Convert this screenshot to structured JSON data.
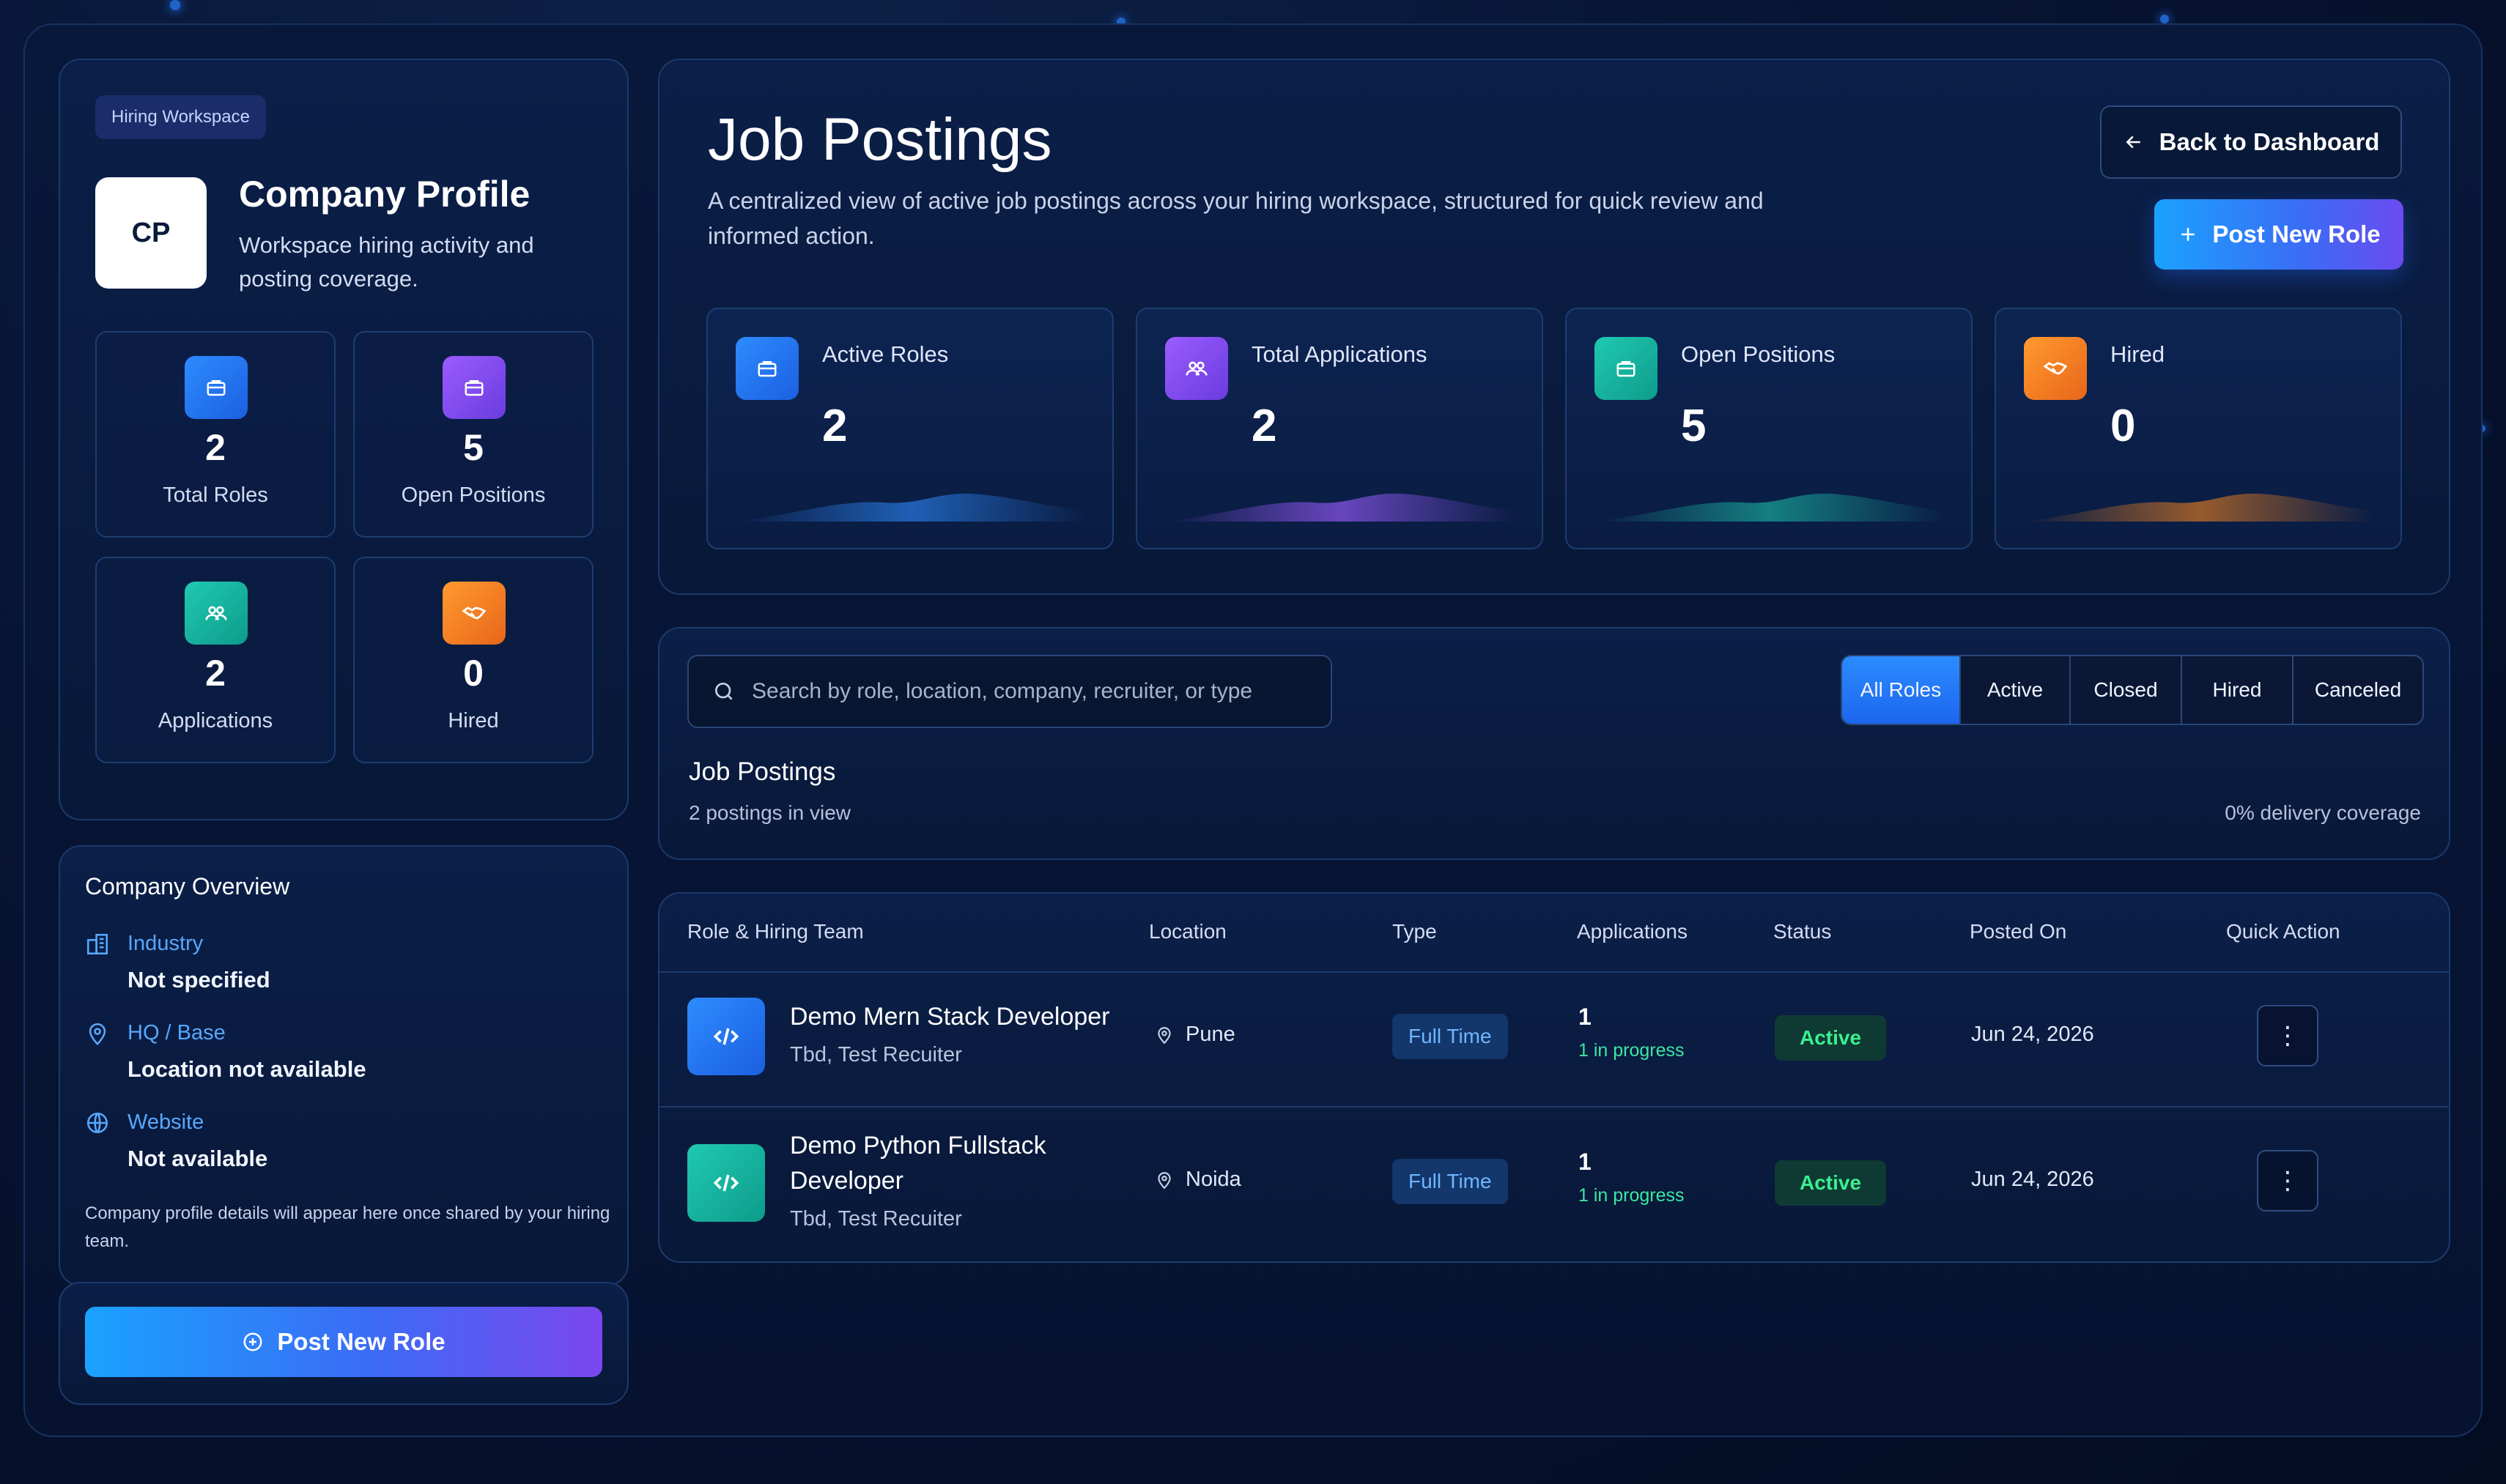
{
  "sidebar": {
    "chip": "Hiring Workspace",
    "logo_initials": "CP",
    "title": "Company Profile",
    "subtitle": "Workspace hiring activity and posting coverage.",
    "tiles": [
      {
        "value": "2",
        "label": "Total Roles",
        "icon": "briefcase-icon"
      },
      {
        "value": "5",
        "label": "Open Positions",
        "icon": "briefcase-icon"
      },
      {
        "value": "2",
        "label": "Applications",
        "icon": "users-icon"
      },
      {
        "value": "0",
        "label": "Hired",
        "icon": "handshake-icon"
      }
    ]
  },
  "overview": {
    "title": "Company Overview",
    "items": [
      {
        "key": "Industry",
        "value": "Not specified",
        "icon": "building-icon"
      },
      {
        "key": "HQ / Base",
        "value": "Location not available",
        "icon": "map-pin-icon"
      },
      {
        "key": "Website",
        "value": "Not available",
        "icon": "globe-icon"
      }
    ],
    "note": "Company profile details will appear here once shared by your hiring team."
  },
  "side_cta": {
    "label": "Post New Role",
    "icon": "plus-circle-icon"
  },
  "header": {
    "title": "Job Postings",
    "description": "A centralized view of active job postings across your hiring workspace, structured for quick review and informed action.",
    "back_label": "Back to Dashboard",
    "post_label": "Post New Role"
  },
  "stats": [
    {
      "label": "Active Roles",
      "value": "2",
      "icon": "briefcase-icon"
    },
    {
      "label": "Total Applications",
      "value": "2",
      "icon": "users-icon"
    },
    {
      "label": "Open Positions",
      "value": "5",
      "icon": "briefcase-icon"
    },
    {
      "label": "Hired",
      "value": "0",
      "icon": "handshake-icon"
    }
  ],
  "filter": {
    "search_placeholder": "Search by role, location, company, recruiter, or type",
    "tabs": [
      "All Roles",
      "Active",
      "Closed",
      "Hired",
      "Canceled"
    ],
    "active_tab": "All Roles",
    "section_title": "Job Postings",
    "count_text": "2 postings in view",
    "coverage_text": "0% delivery coverage"
  },
  "table": {
    "columns": [
      "Role & Hiring Team",
      "Location",
      "Type",
      "Applications",
      "Status",
      "Posted On",
      "Quick Action"
    ],
    "rows": [
      {
        "role": "Demo Mern Stack Developer",
        "team": "Tbd, Test Recuiter",
        "location": "Pune",
        "type": "Full Time",
        "applications": "1",
        "progress": "1 in progress",
        "status": "Active",
        "posted": "Jun 24, 2026"
      },
      {
        "role": "Demo Python Fullstack Developer",
        "team": "Tbd, Test Recuiter",
        "location": "Noida",
        "type": "Full Time",
        "applications": "1",
        "progress": "1 in progress",
        "status": "Active",
        "posted": "Jun 24, 2026"
      }
    ]
  },
  "colors": {
    "accent_blue": "#2d8cff",
    "accent_purple": "#8b52f6",
    "accent_teal": "#1cc0a9",
    "accent_orange": "#f5851f",
    "status_green": "#3bf08f"
  }
}
